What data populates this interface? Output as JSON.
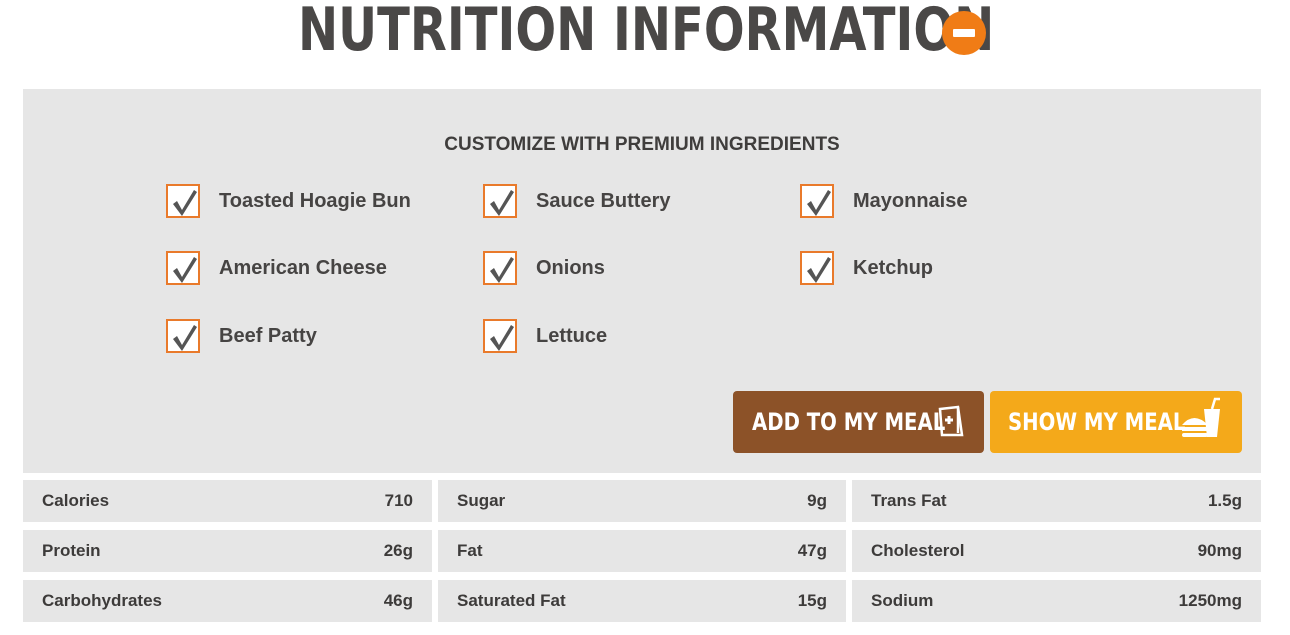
{
  "header": {
    "title": "NUTRITION INFORMATION",
    "collapse_icon": "minus-circle-icon",
    "accent_color": "#f07c16"
  },
  "customize": {
    "heading": "CUSTOMIZE WITH PREMIUM INGREDIENTS",
    "ingredients": [
      {
        "label": "Toasted Hoagie Bun",
        "checked": true
      },
      {
        "label": "Sauce Buttery",
        "checked": true
      },
      {
        "label": "Mayonnaise",
        "checked": true
      },
      {
        "label": "American Cheese",
        "checked": true
      },
      {
        "label": "Onions",
        "checked": true
      },
      {
        "label": "Ketchup",
        "checked": true
      },
      {
        "label": "Beef Patty",
        "checked": true
      },
      {
        "label": "Lettuce",
        "checked": true
      }
    ]
  },
  "actions": {
    "add_to_meal_label": "ADD TO MY MEAL",
    "add_to_meal_icon": "add-to-bag-icon",
    "add_to_meal_color": "#8c5228",
    "show_meal_label": "SHOW MY MEAL",
    "show_meal_icon": "burger-and-drink-icon",
    "show_meal_color": "#f4a91a"
  },
  "nutrition": [
    {
      "name": "Calories",
      "value": "710"
    },
    {
      "name": "Sugar",
      "value": "9g"
    },
    {
      "name": "Trans Fat",
      "value": "1.5g"
    },
    {
      "name": "Protein",
      "value": "26g"
    },
    {
      "name": "Fat",
      "value": "47g"
    },
    {
      "name": "Cholesterol",
      "value": "90mg"
    },
    {
      "name": "Carbohydrates",
      "value": "46g"
    },
    {
      "name": "Saturated Fat",
      "value": "15g"
    },
    {
      "name": "Sodium",
      "value": "1250mg"
    }
  ]
}
